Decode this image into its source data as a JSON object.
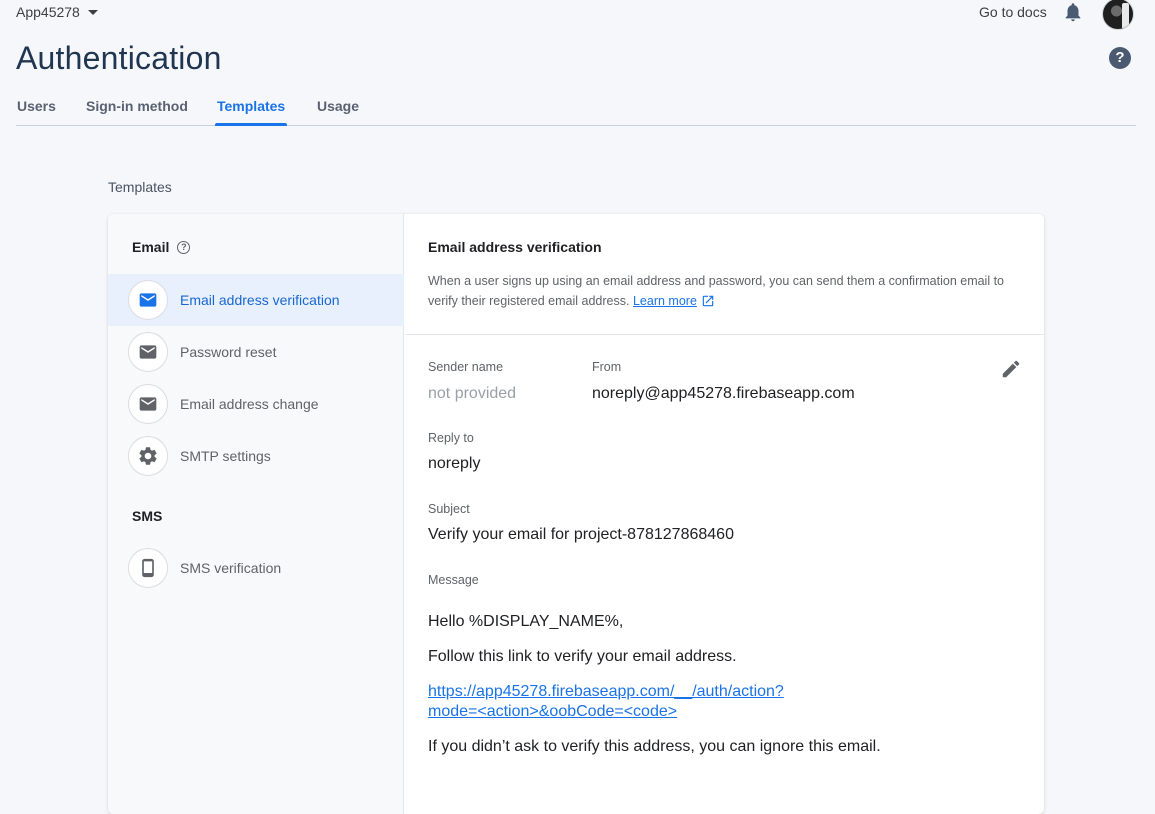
{
  "header": {
    "project": "App45278",
    "docs_link": "Go to docs"
  },
  "page": {
    "title": "Authentication"
  },
  "tabs": [
    {
      "label": "Users"
    },
    {
      "label": "Sign-in method"
    },
    {
      "label": "Templates",
      "active": true
    },
    {
      "label": "Usage"
    }
  ],
  "section_label": "Templates",
  "sidebar": {
    "email_heading": "Email",
    "email_items": [
      {
        "label": "Email address verification",
        "icon": "mail-icon",
        "selected": true
      },
      {
        "label": "Password reset",
        "icon": "mail-icon"
      },
      {
        "label": "Email address change",
        "icon": "mail-icon"
      },
      {
        "label": "SMTP settings",
        "icon": "gear-icon"
      }
    ],
    "sms_heading": "SMS",
    "sms_items": [
      {
        "label": "SMS verification",
        "icon": "phone-icon"
      }
    ]
  },
  "detail": {
    "title": "Email address verification",
    "description": "When a user signs up using an email address and password, you can send them a confirmation email to verify their registered email address.",
    "learn_more": "Learn more",
    "sender_name_label": "Sender name",
    "sender_name_value": "not provided",
    "from_label": "From",
    "from_value": "noreply@app45278.firebaseapp.com",
    "reply_to_label": "Reply to",
    "reply_to_value": "noreply",
    "subject_label": "Subject",
    "subject_value": "Verify your email for project-878127868460",
    "message_label": "Message",
    "message_lines": [
      "Hello %DISPLAY_NAME%,",
      "Follow this link to verify your email address.",
      "https://app45278.firebaseapp.com/__/auth/action?mode=<action>&oobCode=<code>",
      "If you didn’t ask to verify this address, you can ignore this email."
    ]
  },
  "colors": {
    "accent": "#1a73e8",
    "title": "#1f3550",
    "selected_bg": "#e8f0fe"
  }
}
